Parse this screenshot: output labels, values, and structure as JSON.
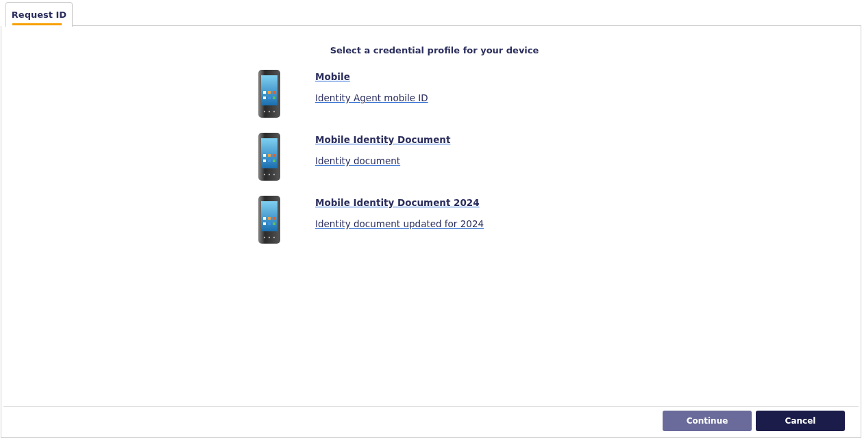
{
  "tabs": [
    {
      "label": "Request ID",
      "selected": true
    }
  ],
  "heading": "Select a credential profile for your device",
  "profiles": [
    {
      "name": "Mobile",
      "description": "Identity Agent mobile ID"
    },
    {
      "name": "Mobile Identity Document",
      "description": "Identity document"
    },
    {
      "name": "Mobile Identity Document 2024",
      "description": "Identity document updated for 2024"
    }
  ],
  "buttons": [
    {
      "label": "Continue",
      "disabled": true
    },
    {
      "label": "Cancel",
      "disabled": false
    }
  ]
}
